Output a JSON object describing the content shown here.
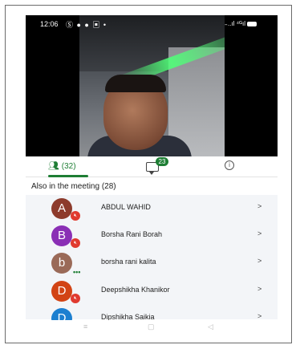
{
  "status": {
    "time": "12:06",
    "left_icons": "Ⓢ ● ● ▣ •",
    "right_text": "̵ ..ıl ⁴ᴳıl"
  },
  "tabs": {
    "people_count": "(32)",
    "chat_badge": "23"
  },
  "section_title": "Also in the meeting (28)",
  "participants": [
    {
      "initial": "A",
      "name": "ABDUL WAHID",
      "color": "#8d3b2c",
      "status": "muted"
    },
    {
      "initial": "B",
      "name": "Borsha Rani Borah",
      "color": "#8a2fb5",
      "status": "muted"
    },
    {
      "initial": "b",
      "name": "borsha rani kalita",
      "color": "#9a6a58",
      "status": "speaking"
    },
    {
      "initial": "D",
      "name": "Deepshikha Khanikor",
      "color": "#d24415",
      "status": "muted"
    },
    {
      "initial": "D",
      "name": "Dipshikha Saikia",
      "color": "#1c7fd0",
      "status": "muted"
    }
  ],
  "chevron": ">",
  "nav": {
    "menu": "≡",
    "home": "▢",
    "back": "◁"
  },
  "colors": {
    "accent": "#1e7e34",
    "mute": "#e03a2f",
    "list_bg": "#f3f5f8"
  }
}
